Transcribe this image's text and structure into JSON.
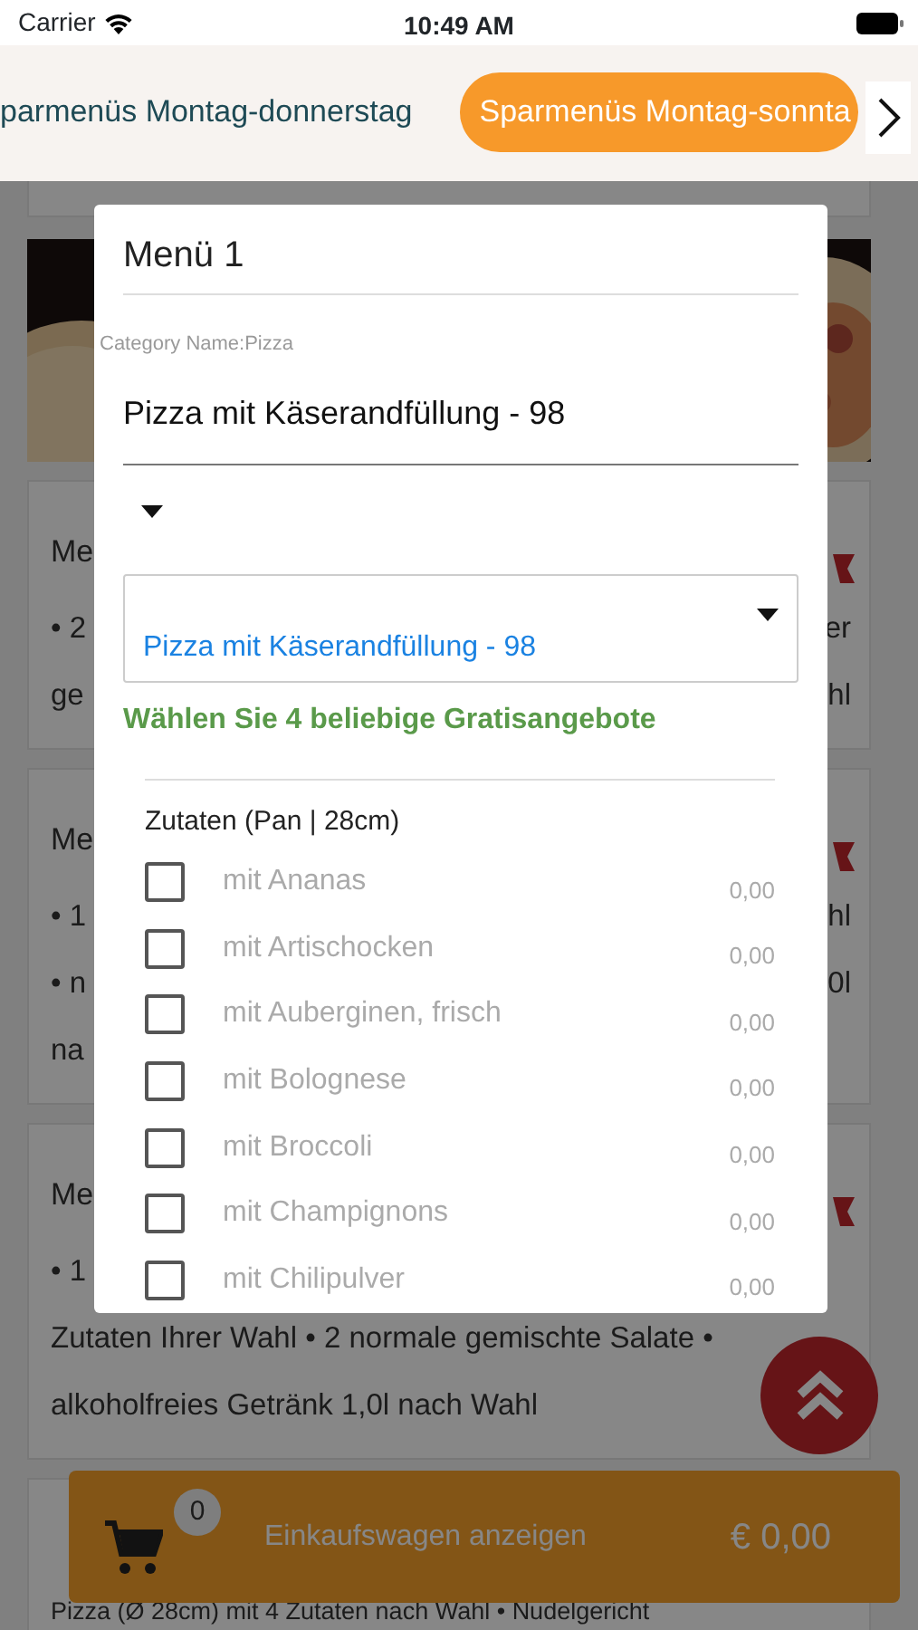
{
  "status_bar": {
    "carrier": "Carrier",
    "time": "10:49 AM"
  },
  "tabs": [
    {
      "label": "parmenüs Montag-donnerstag",
      "selected": false
    },
    {
      "label": "Sparmenüs Montag-sonnta",
      "selected": true
    }
  ],
  "background_cards": [
    {
      "kind": "picture"
    },
    {
      "kind": "menu",
      "title": "Me",
      "lines": [
        {
          "left": "• 2",
          "right": "er"
        },
        {
          "left": "ge",
          "right": "hl"
        }
      ]
    },
    {
      "kind": "menu",
      "title": "Me",
      "lines": [
        {
          "left": "• 1",
          "right": "hl"
        },
        {
          "left": "• n",
          "right": "0l"
        },
        {
          "left": "na"
        }
      ]
    },
    {
      "kind": "menu",
      "title": "Me",
      "lines": [
        {
          "left": "• 1"
        },
        {
          "left": "Zutaten Ihrer Wahl • 2 normale gemischte Salate •"
        },
        {
          "left": "alkoholfreies Getränk 1,0l nach Wahl"
        }
      ]
    },
    {
      "kind": "menu",
      "lines": [
        {
          "left": "Pizza (Ø 28cm) mit 4 Zutaten nach Wahl • Nudelgericht"
        }
      ]
    }
  ],
  "modal": {
    "title": "Menü 1",
    "category": "Category Name:Pizza",
    "product_value": "Pizza mit Käserandfüllung - 98",
    "select_value": "Pizza mit Käserandfüllung - 98",
    "hint": "Wählen Sie 4 beliebige Gratisangebote",
    "group_title": "Zutaten (Pan | 28cm)",
    "options": [
      {
        "label": "mit Ananas",
        "price": "0,00",
        "checked": false
      },
      {
        "label": "mit Artischocken",
        "price": "0,00",
        "checked": false
      },
      {
        "label": "mit Auberginen, frisch",
        "price": "0,00",
        "checked": false
      },
      {
        "label": "mit Bolognese",
        "price": "0,00",
        "checked": false
      },
      {
        "label": "mit Broccoli",
        "price": "0,00",
        "checked": false
      },
      {
        "label": "mit Champignons",
        "price": "0,00",
        "checked": false
      },
      {
        "label": "mit Chilipulver",
        "price": "0,00",
        "checked": false
      }
    ]
  },
  "cart": {
    "count": "0",
    "label": "Einkaufswagen anzeigen",
    "total": "€ 0,00"
  }
}
